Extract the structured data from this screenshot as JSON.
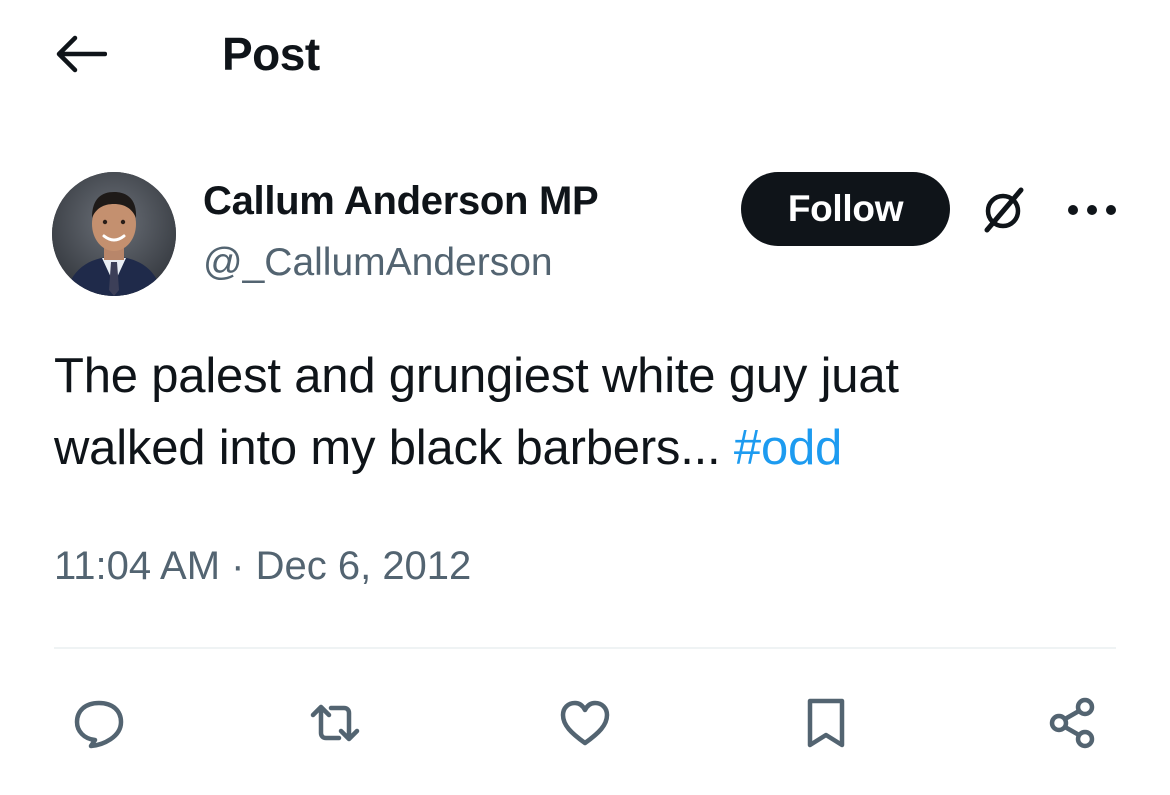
{
  "header": {
    "title": "Post",
    "back_icon": "arrow-left-icon"
  },
  "author": {
    "display_name": "Callum Anderson MP",
    "handle": "@_CallumAnderson",
    "avatar_description": "profile-photo"
  },
  "actions_top": {
    "follow_label": "Follow",
    "grok_icon": "grok-icon",
    "more_icon": "more-horizontal-icon"
  },
  "post": {
    "text_line1": "The palest and grungiest white guy juat",
    "text_line2": "walked into my black barbers... ",
    "hashtag": "#odd",
    "time": "11:04 AM",
    "separator": " · ",
    "date": "Dec 6, 2012"
  },
  "action_bar": [
    {
      "name": "reply",
      "icon": "reply-icon"
    },
    {
      "name": "repost",
      "icon": "repost-icon"
    },
    {
      "name": "like",
      "icon": "heart-icon"
    },
    {
      "name": "bookmark",
      "icon": "bookmark-icon"
    },
    {
      "name": "share",
      "icon": "share-icon"
    }
  ],
  "colors": {
    "text_primary": "#0f1419",
    "text_secondary": "#536471",
    "link": "#1d9bf0",
    "button_bg": "#0f1419",
    "divider": "#eff3f4"
  }
}
